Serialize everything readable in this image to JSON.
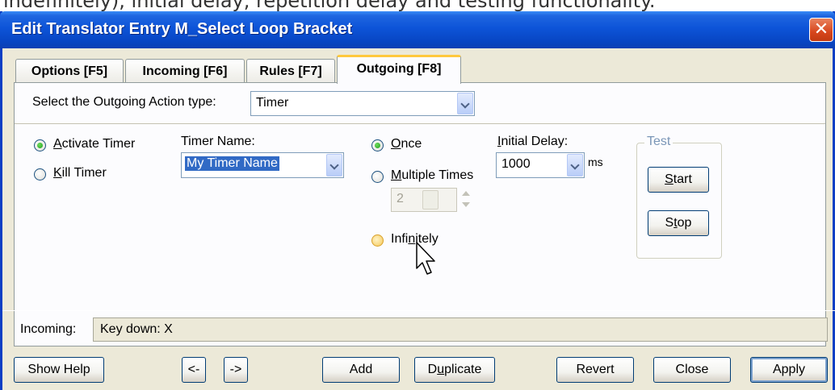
{
  "caption": "indefinitely), initial delay, repetition delay and testing functionality.",
  "window": {
    "title": "Edit Translator Entry M_Select Loop Bracket",
    "close_glyph": "✕"
  },
  "tabs": [
    {
      "label": "Options [F5]"
    },
    {
      "label": "Incoming [F6]"
    },
    {
      "label": "Rules [F7]"
    },
    {
      "label": "Outgoing [F8]",
      "active": true
    }
  ],
  "outgoing": {
    "action_type_label": "Select the Outgoing Action type:",
    "action_type_value": "Timer",
    "activate_timer": {
      "pre": "",
      "accel": "A",
      "post": "ctivate Timer",
      "checked": true
    },
    "kill_timer": {
      "pre": "",
      "accel": "K",
      "post": "ill Timer",
      "checked": false
    },
    "timer_name_label": "Timer Name:",
    "timer_name_value": "My Timer Name",
    "once": {
      "pre": "",
      "accel": "O",
      "post": "nce",
      "checked": true
    },
    "multiple": {
      "pre": "",
      "accel": "M",
      "post": "ultiple Times",
      "checked": false
    },
    "multiple_count": "2",
    "infinitely": {
      "pre": "Infi",
      "accel": "n",
      "post": "itely",
      "checked": false
    },
    "initial_delay_label_pre": "",
    "initial_delay_label_accel": "I",
    "initial_delay_label_post": "nitial Delay:",
    "initial_delay_value": "1000",
    "delay_unit": "ms",
    "test_group_label": "Test",
    "start_button": {
      "accel": "S",
      "rest": "tart"
    },
    "stop_button": {
      "pre": "S",
      "accel": "t",
      "rest": "op"
    }
  },
  "status": {
    "incoming_label": "Incoming:",
    "incoming_value": "Key down: X"
  },
  "footer": {
    "show_help": "Show Help",
    "prev": "<-",
    "next": "->",
    "add": "Add",
    "duplicate": {
      "pre": "D",
      "accel": "u",
      "rest": "plicate"
    },
    "revert": "Revert",
    "close": "Close",
    "apply": "Apply"
  },
  "colors": {
    "titlebar": "#0846c4",
    "dialog_face": "#ece9d8",
    "active_tab_highlight": "#ffc83c",
    "radio_checked": "#21a121"
  }
}
